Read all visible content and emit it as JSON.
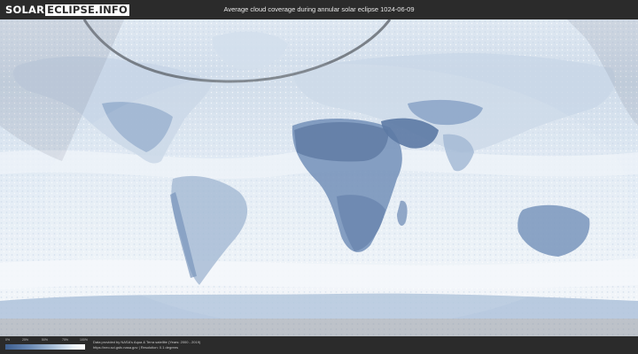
{
  "header": {
    "logo_part1": "SOLAR",
    "logo_part2": "ECLIPSE.INFO",
    "title": "Average cloud coverage during annular solar eclipse 1024-06-09"
  },
  "map": {
    "colors": {
      "ocean_cloud": "#d9e5f1",
      "clear_land": "#5a7aa8",
      "dense_cloud": "#f2f6fa",
      "night_shade": "#bfc6cf",
      "frame": "#2b2b2b"
    }
  },
  "legend": {
    "ticks": [
      "0%",
      "25%",
      "50%",
      "75%",
      "100%"
    ],
    "gradient": [
      "#3e5f8f",
      "#6a89b3",
      "#a9bfd8",
      "#e9f0f7",
      "#ffffff"
    ]
  },
  "footer": {
    "credit_line1": "Data provided by NASA's Aqua & Terra satellite (Years: 2000 - 2019)",
    "credit_line2": "https://neo.sci.gsfc.nasa.gov  |  Resolution: 0.1 degrees"
  }
}
